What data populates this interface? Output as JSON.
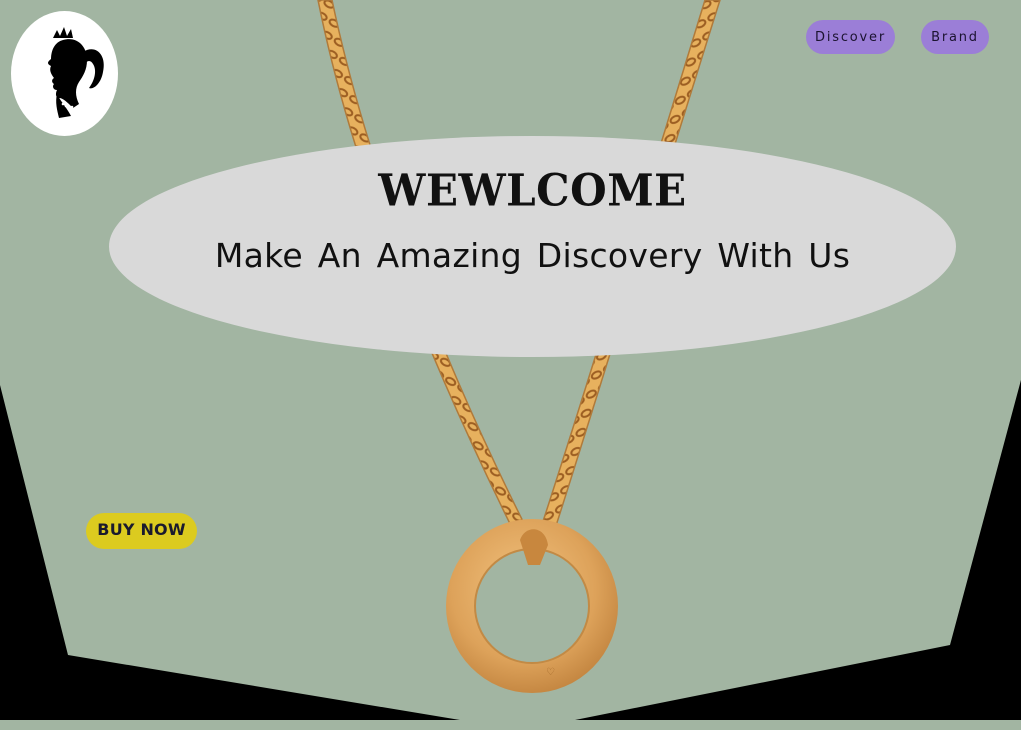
{
  "nav": {
    "items": [
      {
        "label": "Discover"
      },
      {
        "label": "Brand"
      }
    ]
  },
  "hero": {
    "title": "WEWLCOME",
    "subtitle": "Make An Amazing Discovery With Us"
  },
  "cta": {
    "buy_label": "BUY NOW"
  },
  "logo": {
    "icon": "princess-silhouette-icon"
  },
  "colors": {
    "background": "#A2B5A2",
    "frame": "#000000",
    "nav_button": "#9B7ED7",
    "hero_ellipse": "#D9D9D9",
    "buy_button": "#DCCB1F",
    "gold": "#D9A04F"
  }
}
